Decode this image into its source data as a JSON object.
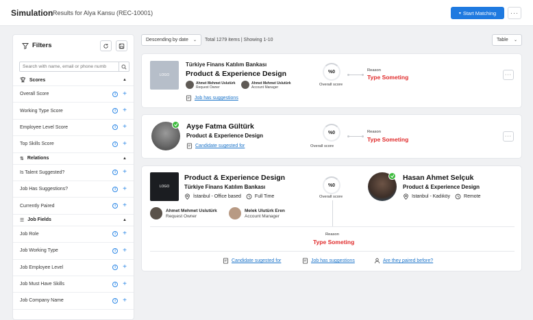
{
  "header": {
    "title": "Simulation",
    "subtitle": "Results for Alya Kansu (REC-10001)",
    "start_matching_label": "Start Matching",
    "more_label": "···"
  },
  "sidebar": {
    "title": "Filters",
    "search_placeholder": "Search with name, email or phone numb",
    "sections": {
      "scores": "Scores",
      "relations": "Relations",
      "job_fields": "Job Fields"
    },
    "score_items": [
      "Overall Score",
      "Working Type Score",
      "Employee Level Score",
      "Top Skills Score"
    ],
    "relation_items": [
      "Is Talent Suggested?",
      "Job Has Suggestions?",
      "Currently Paired"
    ],
    "job_items": [
      "Job Role",
      "Job Working Type",
      "Job Employee Level",
      "Job Must Have Skills",
      "Job Company Name"
    ]
  },
  "toolbar": {
    "sort_label": "Descending by date",
    "count_text": "Total 1279 items | Showing 1-10",
    "view_label": "Table"
  },
  "cards": [
    {
      "company": "Türkiye Finans Katılım Bankası",
      "role": "Product & Experience Design",
      "logo_text": "LOGO",
      "people": [
        {
          "name": "Ahmet Mehmet Uslutürk",
          "role": "Request Owner"
        },
        {
          "name": "Ahmet Mehmet Uslutürk",
          "role": "Account Manager"
        }
      ],
      "link": "Job has suggestions",
      "score": "%0",
      "score_label": "Overall score",
      "reason_label": "Reason",
      "reason_value": "Type Someting"
    },
    {
      "name": "Ayşe Fatma Gültürk",
      "role": "Product & Experience Design",
      "link": "Candidate sugested for",
      "score": "%0",
      "score_label": "Overall score",
      "reason_label": "Reason",
      "reason_value": "Type Someting"
    },
    {
      "role": "Product & Experience Design",
      "company": "Türkiye Finans Katılım Bankası",
      "logo_text": "LOGO",
      "location": "İstanbul - Office based",
      "work_type": "Full Time",
      "people": [
        {
          "name": "Ahmet Mehmet Uslutürk",
          "role": "Request Owner"
        },
        {
          "name": "Melek Ulutürk Eren",
          "role": "Account Manager"
        }
      ],
      "score": "%0",
      "score_label": "Overall score",
      "candidate_name": "Hasan Ahmet Selçuk",
      "candidate_role": "Product & Experience Design",
      "candidate_location": "Istanbul - Kadıköy",
      "candidate_work": "Remote",
      "reason_label": "Reason",
      "reason_value": "Type Someting",
      "links": [
        "Candidate sugested for",
        "Job has suggestions",
        "Are they paired before?"
      ]
    }
  ],
  "colors": {
    "accent": "#1f7ae0",
    "reason": "#e02b2b",
    "badge": "#3dbb3d"
  }
}
